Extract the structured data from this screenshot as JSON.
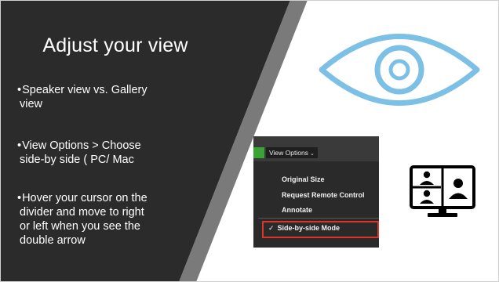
{
  "slide": {
    "title": "Adjust your view",
    "bullets": [
      {
        "marker": "•",
        "lines": [
          "Speaker view vs. Gallery",
          "view"
        ]
      },
      {
        "marker": "•",
        "lines": [
          "View Options > Choose",
          "side-by side ( PC/ Mac"
        ]
      },
      {
        "marker": "•",
        "lines": [
          "Hover your cursor on the",
          "divider and move to right",
          "or left when you see the",
          "double arrow"
        ]
      }
    ]
  },
  "menu_screenshot": {
    "button_label": "View Options",
    "caret": "⌄",
    "items": [
      "Original Size",
      "Request Remote Control",
      "Annotate"
    ],
    "selected_item": "Side-by-side Mode",
    "check_mark": "✓"
  },
  "icons": {
    "eye": "eye-icon",
    "gallery": "gallery-view-icon"
  },
  "colors": {
    "dark_panel": "#2b2b2b",
    "stripe": "#7a7a7a",
    "eye_blue": "#7cc0e6",
    "highlight_red": "#d8342a",
    "zoom_green": "#3aa335"
  }
}
